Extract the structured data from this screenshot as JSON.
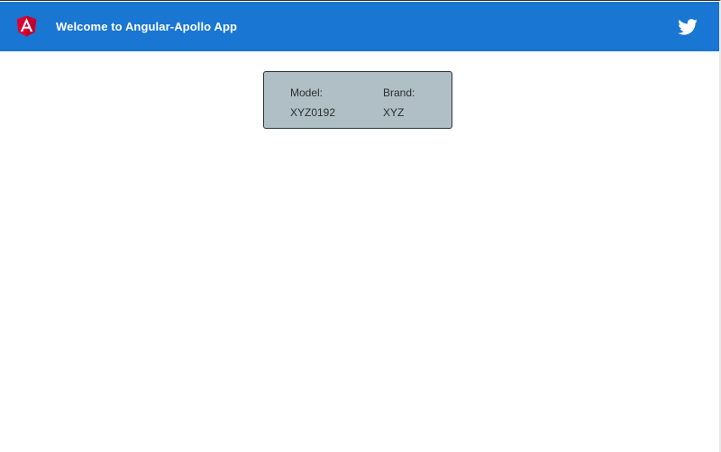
{
  "header": {
    "title": "Welcome to Angular-Apollo App",
    "logo_icon": "angular-logo-icon",
    "social_icon": "twitter-icon",
    "background_color": "#1976d2"
  },
  "card": {
    "background_color": "#b0bec5",
    "fields": [
      {
        "label": "Model:",
        "value": "XYZ0192"
      },
      {
        "label": "Brand:",
        "value": "XYZ"
      }
    ]
  }
}
